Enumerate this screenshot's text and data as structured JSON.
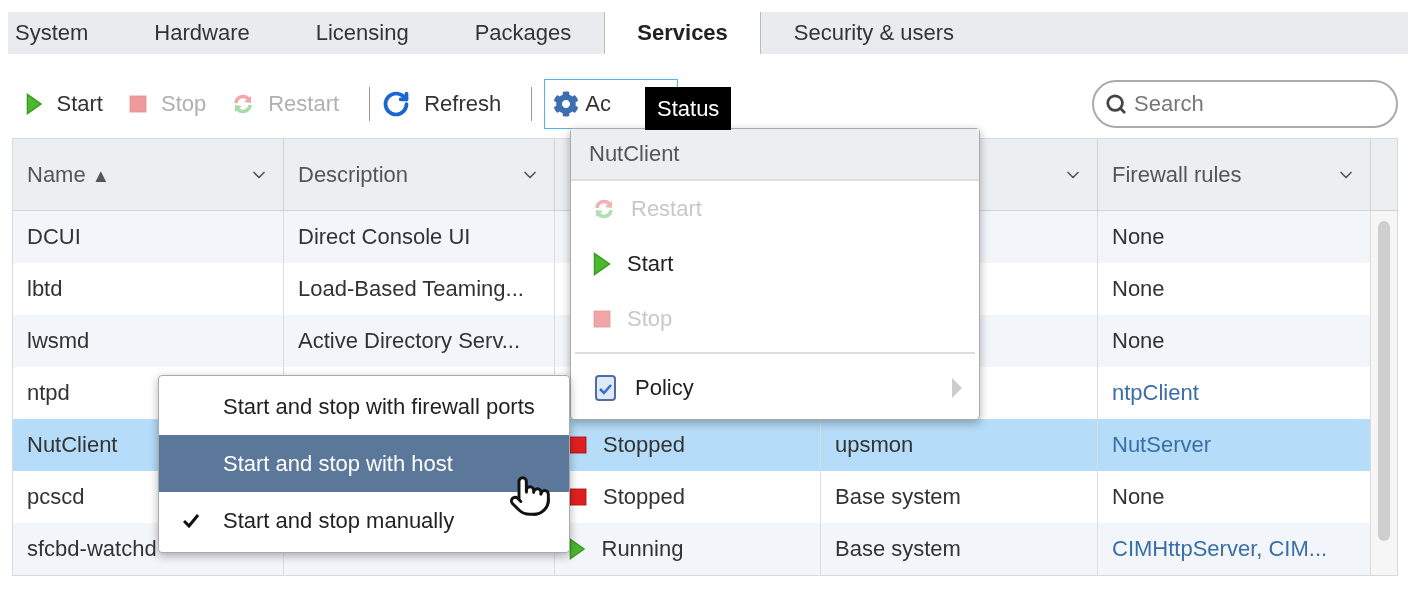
{
  "tabs": [
    {
      "label": "System",
      "selected": false
    },
    {
      "label": "Hardware",
      "selected": false
    },
    {
      "label": "Licensing",
      "selected": false
    },
    {
      "label": "Packages",
      "selected": false
    },
    {
      "label": "Services",
      "selected": true
    },
    {
      "label": "Security & users",
      "selected": false
    }
  ],
  "toolbar": [
    {
      "kind": "start",
      "label": "Start",
      "disabled": false
    },
    {
      "kind": "stop",
      "label": "Stop",
      "disabled": true
    },
    {
      "kind": "restart",
      "label": "Restart",
      "disabled": true
    },
    {
      "kind": "separator"
    },
    {
      "kind": "refresh",
      "label": "Refresh",
      "disabled": false
    },
    {
      "kind": "separator"
    },
    {
      "kind": "actions",
      "label": "Ac",
      "focused": true
    }
  ],
  "tooltip": {
    "text": "Status"
  },
  "search": {
    "placeholder": "Search"
  },
  "table": {
    "columns": [
      {
        "label": "Name",
        "sort_indicator": "▲",
        "filter_arrow": true
      },
      {
        "label": "Description",
        "filter_arrow": true
      },
      {},
      {
        "filter_arrow": true
      },
      {
        "label": "Firewall rules",
        "filter_arrow": true
      }
    ],
    "rows": [
      {
        "name": "DCUI",
        "description": "Direct Console UI",
        "firewall_rules": {
          "text": "None",
          "link": false
        },
        "selected": false
      },
      {
        "name": "lbtd",
        "description": "Load-Based Teaming...",
        "firewall_rules": {
          "text": "None",
          "link": false
        },
        "selected": false
      },
      {
        "name": "lwsmd",
        "description": "Active Directory Serv...",
        "firewall_rules": {
          "text": "None",
          "link": false
        },
        "selected": false
      },
      {
        "name": "ntpd",
        "firewall_rules": {
          "text": "ntpClient",
          "link": true
        },
        "selected": false
      },
      {
        "name": "NutClient",
        "column_3": {
          "text": "Stopped",
          "kind": "stopped"
        },
        "column_4": "upsmon",
        "firewall_rules": {
          "text": "NutServer",
          "link": true
        },
        "selected": true
      },
      {
        "name": "pcscd",
        "column_3": {
          "text": "Stopped",
          "kind": "stopped"
        },
        "column_4": "Base system",
        "firewall_rules": {
          "text": "None",
          "link": false
        },
        "selected": false
      },
      {
        "name": "sfcbd-watchd",
        "column_3": {
          "text": "Running",
          "kind": "running"
        },
        "column_4": "Base system",
        "firewall_rules": {
          "text": "CIMHttpServer, CIM...",
          "link": true
        },
        "selected": false
      }
    ]
  },
  "actions_menu": {
    "title": "NutClient",
    "items": [
      {
        "kind": "restart",
        "label": "Restart",
        "disabled": true,
        "submenu": false
      },
      {
        "kind": "start",
        "label": "Start",
        "disabled": false,
        "submenu": false
      },
      {
        "kind": "stop",
        "label": "Stop",
        "disabled": true,
        "submenu": false
      },
      {
        "kind": "separator"
      },
      {
        "kind": "policy",
        "label": "Policy",
        "disabled": false,
        "submenu": true
      }
    ]
  },
  "policy_menu": {
    "items": [
      {
        "label": "Start and stop with firewall ports",
        "checked": false,
        "highlighted": false
      },
      {
        "label": "Start and stop with host",
        "checked": false,
        "highlighted": true
      },
      {
        "label": "Start and stop manually",
        "checked": true,
        "highlighted": false
      }
    ]
  }
}
